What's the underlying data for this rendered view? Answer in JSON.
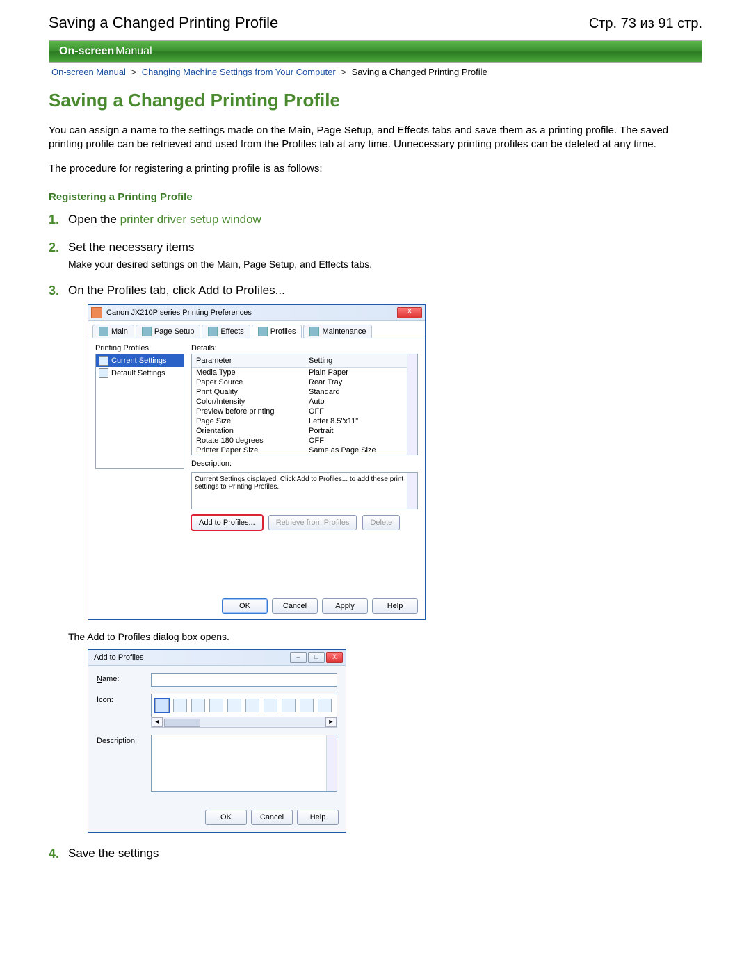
{
  "header": {
    "left": "Saving a Changed Printing Profile",
    "right": "Стр. 73 из 91 стр."
  },
  "banner": {
    "bold": "On-screen",
    "rest": " Manual"
  },
  "breadcrumbs": {
    "a": "On-screen Manual",
    "b": "Changing Machine Settings from Your Computer",
    "c": "Saving a Changed Printing Profile",
    "sep": ">"
  },
  "title": "Saving a Changed Printing Profile",
  "intro1": "You can assign a name to the settings made on the Main, Page Setup, and Effects tabs and save them as a printing profile. The saved printing profile can be retrieved and used from the Profiles tab at any time. Unnecessary printing profiles can be deleted at any time.",
  "intro2": "The procedure for registering a printing profile is as follows:",
  "section1": "Registering a Printing Profile",
  "steps": {
    "s1": {
      "n": "1.",
      "pre": "Open the ",
      "link": "printer driver setup window"
    },
    "s2": {
      "n": "2.",
      "title": "Set the necessary items",
      "sub": "Make your desired settings on the Main, Page Setup, and Effects tabs."
    },
    "s3": {
      "n": "3.",
      "title": "On the Profiles tab, click Add to Profiles...",
      "after": "The Add to Profiles dialog box opens."
    },
    "s4": {
      "n": "4.",
      "title": "Save the settings"
    }
  },
  "prefDlg": {
    "title": "Canon JX210P series Printing Preferences",
    "close": "X",
    "tabs": {
      "main": "Main",
      "page": "Page Setup",
      "effects": "Effects",
      "profiles": "Profiles",
      "maint": "Maintenance"
    },
    "labels": {
      "profiles": "Printing Profiles:",
      "details": "Details:",
      "description": "Description:"
    },
    "profileList": {
      "current": "Current Settings",
      "default": "Default Settings"
    },
    "detailHdr": {
      "param": "Parameter",
      "setting": "Setting"
    },
    "detailRows": [
      {
        "p": "Media Type",
        "s": "Plain Paper"
      },
      {
        "p": "Paper Source",
        "s": "Rear Tray"
      },
      {
        "p": "Print Quality",
        "s": "Standard"
      },
      {
        "p": "Color/Intensity",
        "s": "Auto"
      },
      {
        "p": "Preview before printing",
        "s": "OFF"
      },
      {
        "p": "Page Size",
        "s": "Letter 8.5\"x11\""
      },
      {
        "p": "Orientation",
        "s": "Portrait"
      },
      {
        "p": "Rotate 180 degrees",
        "s": "OFF"
      },
      {
        "p": "Printer Paper Size",
        "s": "Same as Page Size"
      }
    ],
    "descText": "Current Settings displayed. Click Add to Profiles... to add these print settings to Printing Profiles.",
    "buttons": {
      "add": "Add to Profiles...",
      "retrieve": "Retrieve from Profiles",
      "delete": "Delete"
    },
    "foot": {
      "ok": "OK",
      "cancel": "Cancel",
      "apply": "Apply",
      "help": "Help"
    }
  },
  "addDlg": {
    "title": "Add to Profiles",
    "labels": {
      "name": "Name:",
      "icon": "Icon:",
      "description": "Description:"
    },
    "foot": {
      "ok": "OK",
      "cancel": "Cancel",
      "help": "Help"
    },
    "winbtns": {
      "min": "–",
      "max": "□",
      "close": "X"
    }
  }
}
